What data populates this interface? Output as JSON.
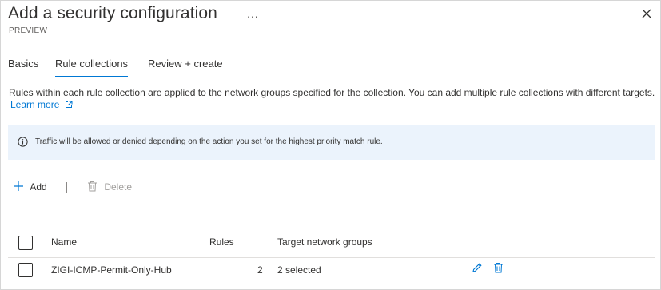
{
  "blade": {
    "title": "Add a security configuration",
    "subtitle": "PREVIEW",
    "more_label": "...",
    "close_icon": "close-icon"
  },
  "tabs": [
    {
      "label": "Basics",
      "active": false
    },
    {
      "label": "Rule collections",
      "active": true
    },
    {
      "label": "Review + create",
      "active": false
    }
  ],
  "description": {
    "text": "Rules within each rule collection are applied to the network groups specified for the collection. You can add multiple rule collections with different targets.",
    "learn_more": "Learn more"
  },
  "info_banner": {
    "text": "Traffic will be allowed or denied depending on the action you set for the highest priority match rule.",
    "background": "#ebf3fc"
  },
  "toolbar": {
    "add_label": "Add",
    "delete_label": "Delete"
  },
  "table": {
    "columns": [
      "Name",
      "Rules",
      "Target network groups"
    ],
    "rows": [
      {
        "name": "ZIGI-ICMP-Permit-Only-Hub",
        "rules": "2",
        "targets": "2 selected"
      }
    ]
  },
  "colors": {
    "accent": "#0078d4",
    "disabled": "#a19f9d",
    "text": "#323130"
  }
}
